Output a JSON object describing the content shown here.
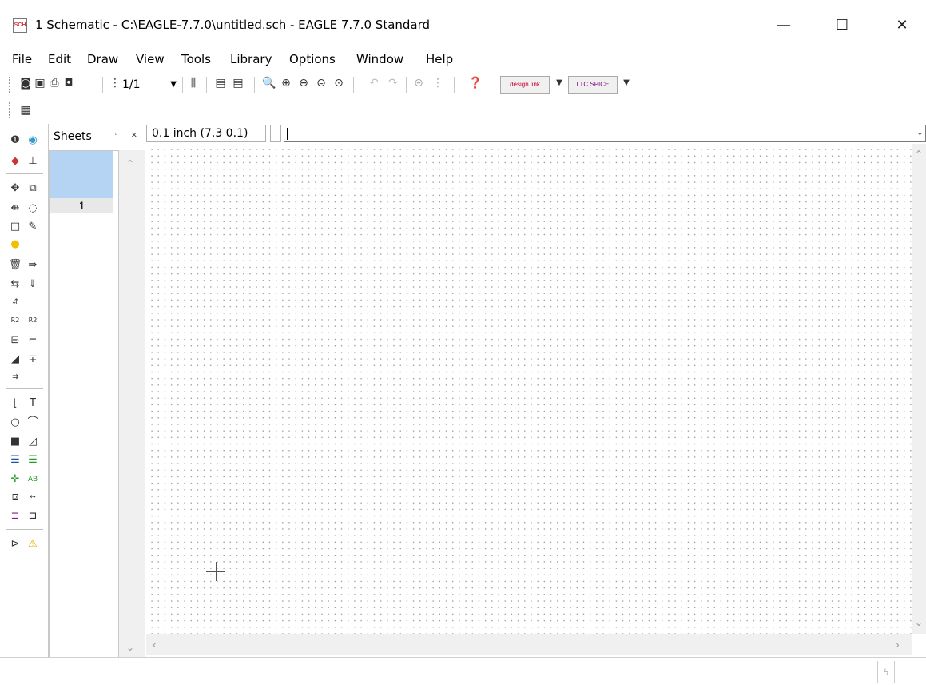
{
  "window": {
    "icon_text": "SCH",
    "title": "1 Schematic - C:\\EAGLE-7.7.0\\untitled.sch - EAGLE 7.7.0 Standard",
    "minimize": "—",
    "maximize": "☐",
    "close": "✕"
  },
  "menu": {
    "items": [
      "File",
      "Edit",
      "Draw",
      "View",
      "Tools",
      "Library",
      "Options",
      "Window",
      "Help"
    ]
  },
  "toolbar": {
    "zoom_value": "1/1",
    "design_link_label": "design link",
    "ltc_spice_label": "LTC SPICE"
  },
  "sheets": {
    "title": "Sheets",
    "float_icon": "▫",
    "close_icon": "×",
    "items": [
      {
        "label": "1"
      }
    ]
  },
  "command": {
    "coordinate_display": "0.1 inch (7.3 0.1)",
    "input_value": ""
  },
  "colors": {
    "sheet_selected": "#b5d4f4",
    "grid_dot": "#9a9a9a",
    "accent_link": "#cc0033"
  }
}
